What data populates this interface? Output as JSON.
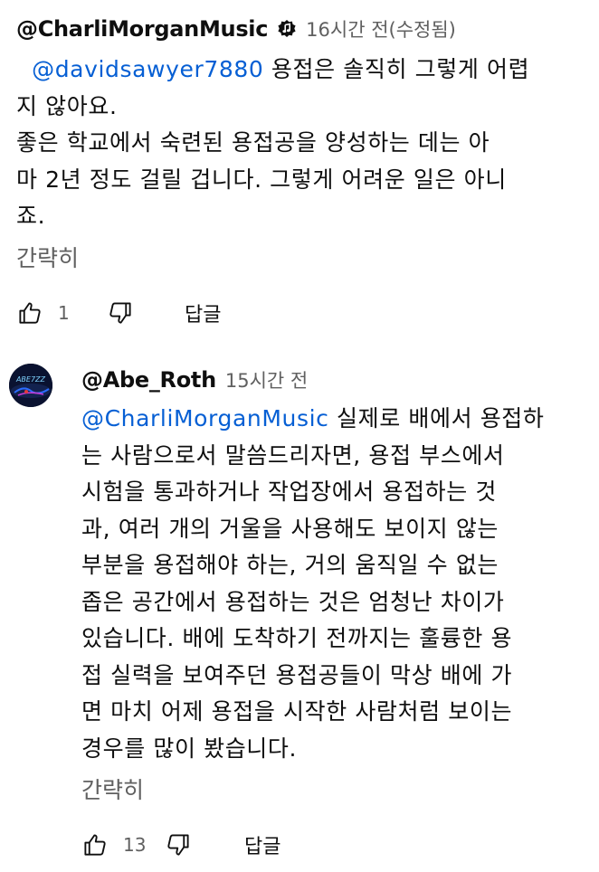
{
  "comments": [
    {
      "author": "@CharliMorganMusic",
      "verified_icon": "music-note-badge-icon",
      "meta": "16시간 전(수정됨)",
      "lines": [
        {
          "mention": "@davidsawyer7880",
          "text": " 용접은 솔직히 그렇게 어렵"
        },
        {
          "text": "지 않아요."
        },
        {
          "text": "좋은 학교에서 숙련된 용접공을 양성하는 데는 아"
        },
        {
          "text": "마 2년 정도 걸릴 겁니다. 그렇게 어려운 일은 아니"
        },
        {
          "text": "죠."
        }
      ],
      "collapse_label": "간략히",
      "like_count": "1",
      "reply_label": "답글"
    },
    {
      "author": "@Abe_Roth",
      "avatar_text": "ABE7ZZ",
      "meta": "15시간 전",
      "lines": [
        {
          "mention": "@CharliMorganMusic",
          "text": " 실제로 배에서 용접하"
        },
        {
          "text": "는 사람으로서 말씀드리자면, 용접 부스에서"
        },
        {
          "text": "시험을 통과하거나 작업장에서 용접하는 것"
        },
        {
          "text": "과, 여러 개의 거울을 사용해도 보이지 않는"
        },
        {
          "text": "부분을 용접해야 하는, 거의 움직일 수 없는"
        },
        {
          "text": "좁은 공간에서 용접하는 것은 엄청난 차이가"
        },
        {
          "text": "있습니다. 배에 도착하기 전까지는 훌륭한 용"
        },
        {
          "text": "접 실력을 보여주던 용접공들이 막상 배에 가"
        },
        {
          "text": "면 마치 어제 용접을 시작한 사람처럼 보이는"
        },
        {
          "text": "경우를 많이 봤습니다."
        }
      ],
      "collapse_label": "간략히",
      "like_count": "13",
      "reply_label": "답글"
    }
  ],
  "colors": {
    "text": "#0f0f0f",
    "secondary": "#606060",
    "mention": "#065fd4"
  }
}
